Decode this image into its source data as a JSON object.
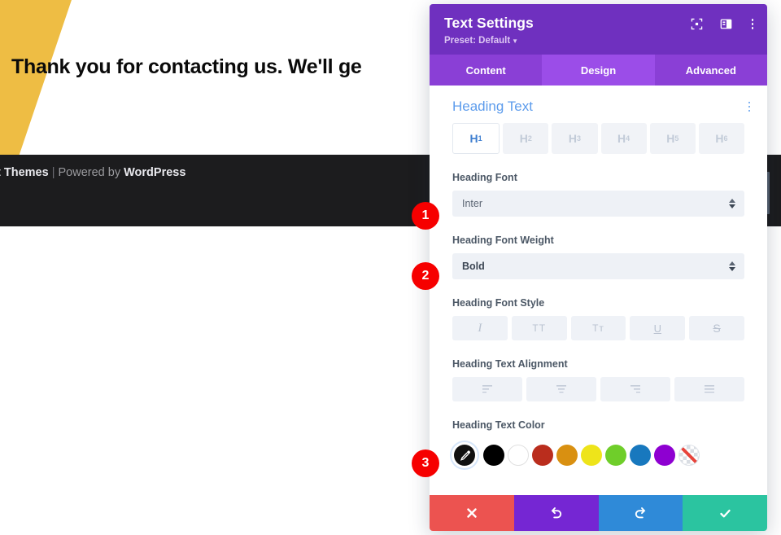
{
  "background": {
    "heading": "Thank you for contacting us. We'll ge",
    "footer_prefix": "t Themes",
    "footer_sep": "|",
    "footer_mid": "Powered by",
    "footer_brand": "WordPress",
    "yellow_shape_color": "#eebd44",
    "footer_bg": "#1c1c1e"
  },
  "panel": {
    "title": "Text Settings",
    "preset_label": "Preset: Default",
    "header_icons": [
      "focus-frame-icon",
      "layout-split-icon",
      "more-options-icon"
    ],
    "accent": "#6f30bf",
    "tabs": [
      {
        "label": "Content",
        "active": false
      },
      {
        "label": "Design",
        "active": true
      },
      {
        "label": "Advanced",
        "active": false
      }
    ],
    "section": {
      "title": "Heading Text",
      "title_color": "#5d9cec"
    },
    "heading_levels": [
      {
        "label": "H",
        "sub": "1",
        "active": true
      },
      {
        "label": "H",
        "sub": "2",
        "active": false
      },
      {
        "label": "H",
        "sub": "3",
        "active": false
      },
      {
        "label": "H",
        "sub": "4",
        "active": false
      },
      {
        "label": "H",
        "sub": "5",
        "active": false
      },
      {
        "label": "H",
        "sub": "6",
        "active": false
      }
    ],
    "heading_font": {
      "label": "Heading Font",
      "value": "Inter"
    },
    "heading_font_weight": {
      "label": "Heading Font Weight",
      "value": "Bold"
    },
    "heading_font_style": {
      "label": "Heading Font Style",
      "buttons": [
        {
          "glyph": "I",
          "name": "italic"
        },
        {
          "glyph": "TT",
          "name": "uppercase"
        },
        {
          "glyph": "Tᴛ",
          "name": "small-caps"
        },
        {
          "glyph": "U",
          "name": "underline"
        },
        {
          "glyph": "S",
          "name": "strikethrough"
        }
      ]
    },
    "heading_text_alignment": {
      "label": "Heading Text Alignment",
      "options": [
        "left",
        "center",
        "right",
        "justify"
      ]
    },
    "heading_text_color": {
      "label": "Heading Text Color",
      "picker_icon": "eyedropper-icon",
      "picker_selected": true,
      "swatches": [
        {
          "name": "black",
          "hex": "#000000"
        },
        {
          "name": "white",
          "hex": "#ffffff"
        },
        {
          "name": "dark-red",
          "hex": "#ba2d1d"
        },
        {
          "name": "orange",
          "hex": "#d99011"
        },
        {
          "name": "yellow",
          "hex": "#eee41a"
        },
        {
          "name": "green",
          "hex": "#6fce2a"
        },
        {
          "name": "blue",
          "hex": "#1878be"
        },
        {
          "name": "purple",
          "hex": "#8e00d1"
        },
        {
          "name": "transparent",
          "hex": "none"
        }
      ]
    },
    "footer_actions": [
      {
        "name": "cancel",
        "icon": "close-icon",
        "color": "#ec5350"
      },
      {
        "name": "undo",
        "icon": "undo-icon",
        "color": "#7526d3"
      },
      {
        "name": "redo",
        "icon": "redo-icon",
        "color": "#2f8ad8"
      },
      {
        "name": "save",
        "icon": "check-icon",
        "color": "#2bc4a0"
      }
    ]
  },
  "badges": [
    {
      "number": "1"
    },
    {
      "number": "2"
    },
    {
      "number": "3"
    }
  ]
}
